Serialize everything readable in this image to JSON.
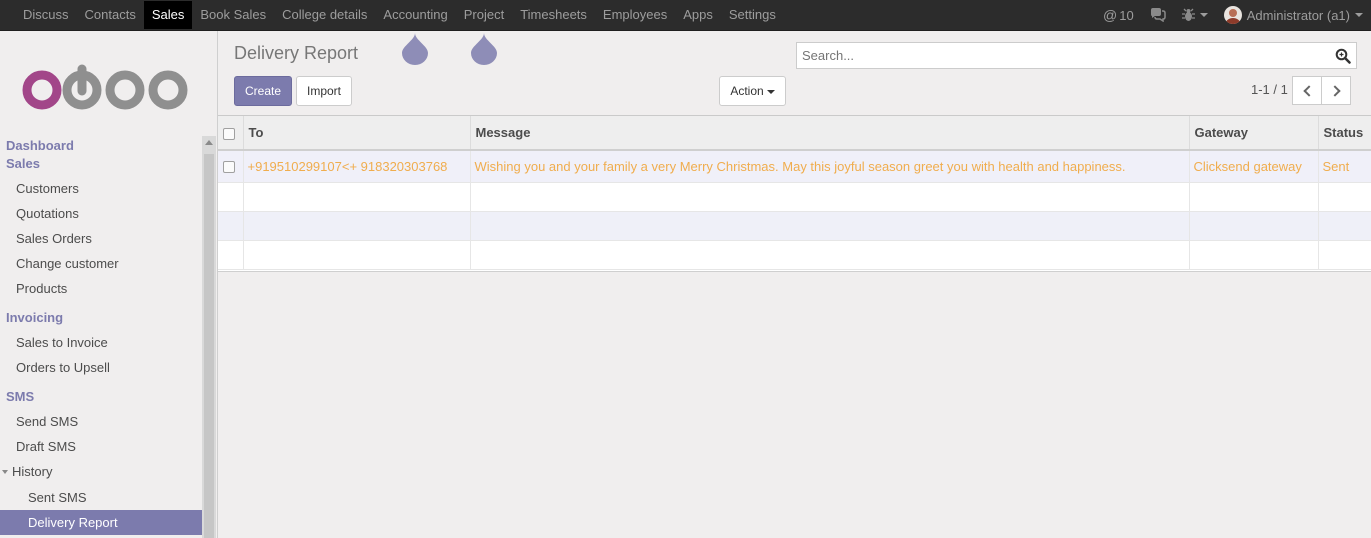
{
  "topbar": {
    "menu": [
      "Discuss",
      "Contacts",
      "Sales",
      "Book Sales",
      "College details",
      "Accounting",
      "Project",
      "Timesheets",
      "Employees",
      "Apps",
      "Settings"
    ],
    "active": "Sales",
    "mentions_count": "10",
    "user": "Administrator (a1)"
  },
  "sidebar": {
    "logo_text": "odoo",
    "sections": [
      {
        "title": "Dashboard"
      },
      {
        "title": "Sales",
        "items": [
          "Customers",
          "Quotations",
          "Sales Orders",
          "Change customer",
          "Products"
        ]
      },
      {
        "title": "Invoicing",
        "items": [
          "Sales to Invoice",
          "Orders to Upsell"
        ]
      },
      {
        "title": "SMS",
        "items": [
          "Send SMS",
          "Draft SMS"
        ]
      }
    ],
    "history": {
      "label": "History",
      "items": [
        "Sent SMS",
        "Delivery Report"
      ],
      "active": "Delivery Report"
    }
  },
  "control": {
    "title": "Delivery Report",
    "search_placeholder": "Search...",
    "create_label": "Create",
    "import_label": "Import",
    "action_label": "Action",
    "pager": "1-1 / 1"
  },
  "table": {
    "columns": [
      "To",
      "Message",
      "Gateway",
      "Status"
    ],
    "rows": [
      {
        "to": "+919510299107<+ 918320303768",
        "message": "Wishing you and your family a very Merry Christmas. May this joyful season greet you with health and happiness.",
        "gateway": "Clicksend gateway",
        "status": "Sent"
      }
    ]
  },
  "colors": {
    "brand": "#7c7bad",
    "topbar": "#2c2c2c",
    "row_text": "#f0ad4e"
  },
  "icons": [
    "at-icon",
    "chat-icon",
    "bug-icon",
    "search-icon",
    "chevron-left-icon",
    "chevron-right-icon"
  ]
}
